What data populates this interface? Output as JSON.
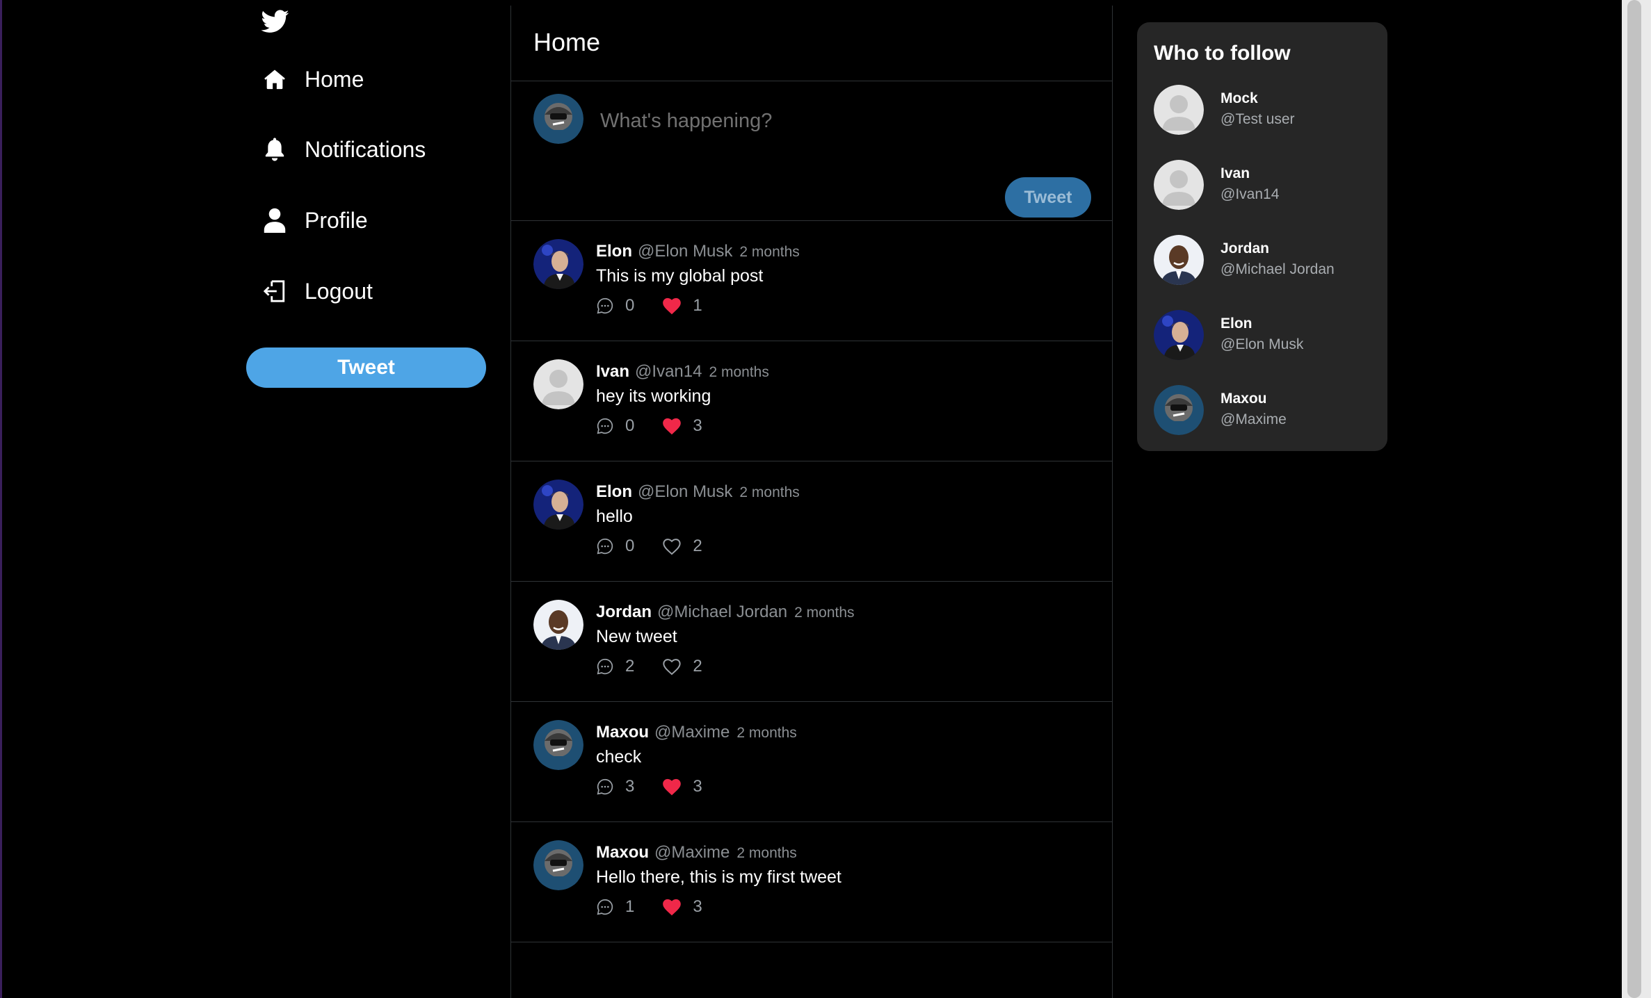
{
  "nav": {
    "items": [
      {
        "label": "Home",
        "icon": "home-icon"
      },
      {
        "label": "Notifications",
        "icon": "bell-icon"
      },
      {
        "label": "Profile",
        "icon": "user-icon"
      },
      {
        "label": "Logout",
        "icon": "logout-icon"
      }
    ],
    "tweet_button": "Tweet"
  },
  "feed": {
    "title": "Home",
    "composer": {
      "placeholder": "What's happening?",
      "button": "Tweet"
    },
    "tweets": [
      {
        "name": "Elon",
        "handle": "@Elon Musk",
        "time": "2 months",
        "text": "This is my global post",
        "comments": "0",
        "likes": "1",
        "liked": true
      },
      {
        "name": "Ivan",
        "handle": "@Ivan14",
        "time": "2 months",
        "text": "hey its working",
        "comments": "0",
        "likes": "3",
        "liked": true
      },
      {
        "name": "Elon",
        "handle": "@Elon Musk",
        "time": "2 months",
        "text": "hello",
        "comments": "0",
        "likes": "2",
        "liked": false
      },
      {
        "name": "Jordan",
        "handle": "@Michael Jordan",
        "time": "2 months",
        "text": "New tweet",
        "comments": "2",
        "likes": "2",
        "liked": false
      },
      {
        "name": "Maxou",
        "handle": "@Maxime",
        "time": "2 months",
        "text": "check",
        "comments": "3",
        "likes": "3",
        "liked": true
      },
      {
        "name": "Maxou",
        "handle": "@Maxime",
        "time": "2 months",
        "text": "Hello there, this is my first tweet",
        "comments": "1",
        "likes": "3",
        "liked": true
      }
    ]
  },
  "who_to_follow": {
    "title": "Who to follow",
    "users": [
      {
        "name": "Mock",
        "handle": "@Test user"
      },
      {
        "name": "Ivan",
        "handle": "@Ivan14"
      },
      {
        "name": "Jordan",
        "handle": "@Michael Jordan"
      },
      {
        "name": "Elon",
        "handle": "@Elon Musk"
      },
      {
        "name": "Maxou",
        "handle": "@Maxime"
      }
    ]
  },
  "colors": {
    "background": "#000000",
    "accent": "#4ea5e6",
    "like_active": "#f02849",
    "muted_text": "#8b8f93",
    "card": "#262626"
  }
}
